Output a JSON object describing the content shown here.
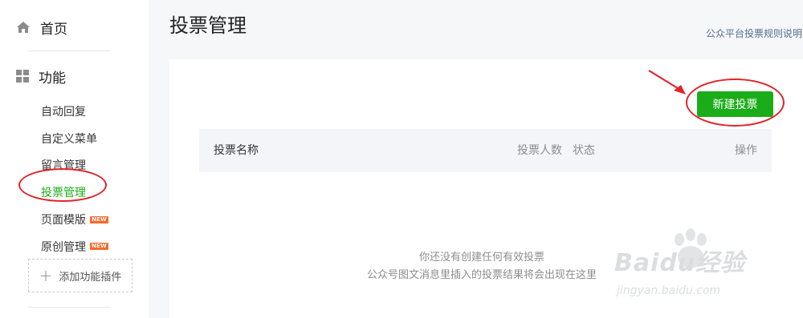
{
  "sidebar": {
    "home_label": "首页",
    "section_label": "功能",
    "items": [
      {
        "label": "自动回复",
        "new": false
      },
      {
        "label": "自定义菜单",
        "new": false
      },
      {
        "label": "留言管理",
        "new": false
      },
      {
        "label": "投票管理",
        "new": false,
        "active": true
      },
      {
        "label": "页面模版",
        "new": true
      },
      {
        "label": "原创管理",
        "new": true
      }
    ],
    "new_badge": "NEW",
    "add_plugin": "添加功能插件"
  },
  "main": {
    "title": "投票管理",
    "rules_link": "公众平台投票规则说明",
    "new_vote_button": "新建投票",
    "table": {
      "columns": [
        "投票名称",
        "投票人数",
        "状态",
        "操作"
      ]
    },
    "empty_line1": "你还没有创建任何有效投票",
    "empty_line2": "公众号图文消息里插入的投票结果将会出现在这里"
  },
  "watermark": {
    "brand": "Baidu经验",
    "url": "jingyan.baidu.com"
  },
  "colors": {
    "accent": "#1aad19",
    "annotation": "#e0242b",
    "link": "#576b95",
    "badge": "#fb6a2a"
  }
}
